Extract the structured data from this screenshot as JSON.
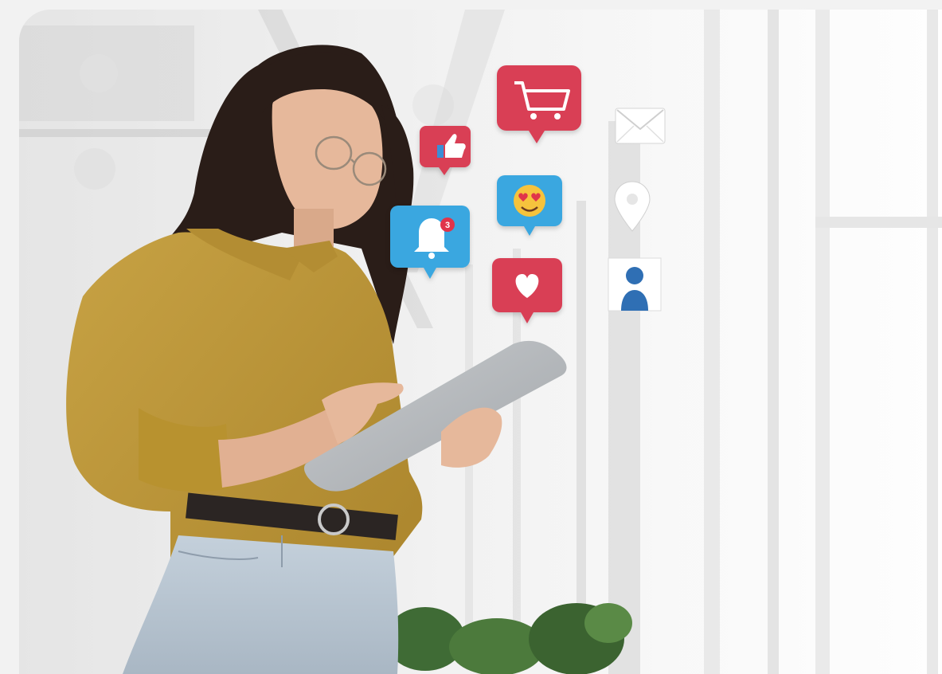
{
  "photo": {
    "subject": "woman-using-tablet",
    "floating_icons": [
      {
        "name": "shopping-cart-icon",
        "color": "#d93f55"
      },
      {
        "name": "thumbs-up-icon",
        "color": "#d93f55"
      },
      {
        "name": "envelope-icon",
        "color": "#ffffff"
      },
      {
        "name": "heart-eyes-emoji-icon",
        "color": "#3aa7e0"
      },
      {
        "name": "notification-bell-icon",
        "color": "#3aa7e0",
        "badge": "3"
      },
      {
        "name": "location-pin-icon",
        "color": "#ffffff"
      },
      {
        "name": "heart-icon",
        "color": "#d93f55"
      },
      {
        "name": "user-profile-icon",
        "color": "#2f6fb4"
      }
    ]
  },
  "colors": {
    "shirt": "#c09a3a",
    "jeans": "#b9c6d2",
    "hair": "#2a1d18",
    "tablet": "#b9bcc0",
    "accent_red": "#d93f55",
    "accent_blue": "#3aa7e0"
  }
}
